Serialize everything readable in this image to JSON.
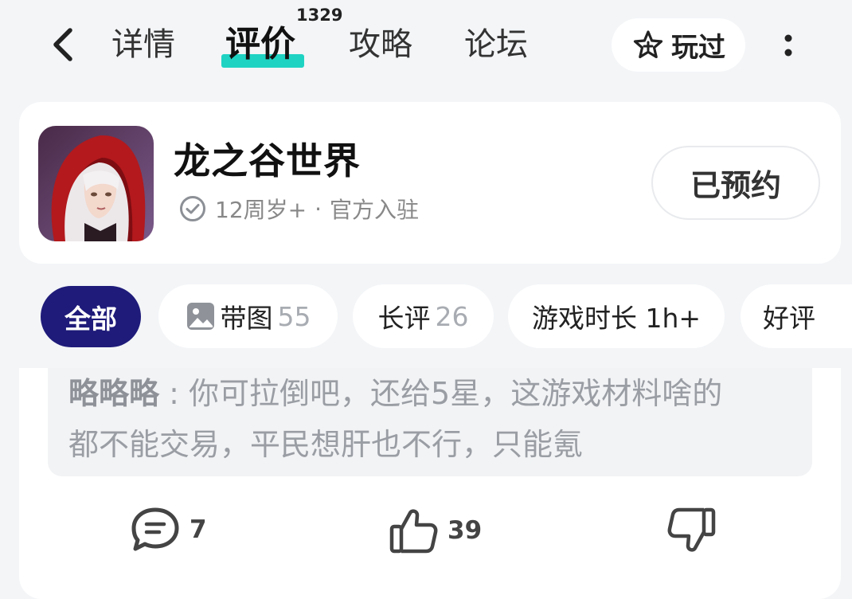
{
  "nav": {
    "tabs": [
      {
        "label": "详情"
      },
      {
        "label": "评价"
      },
      {
        "label": "攻略"
      },
      {
        "label": "论坛"
      }
    ],
    "review_count": "1329",
    "played_label": "玩过",
    "active_tab": "评价",
    "accent_color": "#1fd3c3"
  },
  "game": {
    "name": "龙之谷世界",
    "age_rating": "12周岁+",
    "separator": "·",
    "official": "官方入驻",
    "reserve_label": "已预约"
  },
  "filters": [
    {
      "label": "全部",
      "count": ""
    },
    {
      "label": "带图",
      "count": "55"
    },
    {
      "label": "长评",
      "count": "26"
    },
    {
      "label": "游戏时长 1h+",
      "count": ""
    },
    {
      "label": "好评",
      "count": ""
    }
  ],
  "review": {
    "quote_author": "略略略",
    "quote_colon": ":",
    "quote_line1": "你可拉倒吧，还给5星，这游戏材料啥的",
    "quote_line2": "都不能交易，平民想肝也不行，只能氪",
    "comment_count": "7",
    "like_count": "39"
  },
  "colors": {
    "selected_chip": "#1e1b7a",
    "background": "#f3f5f7"
  }
}
